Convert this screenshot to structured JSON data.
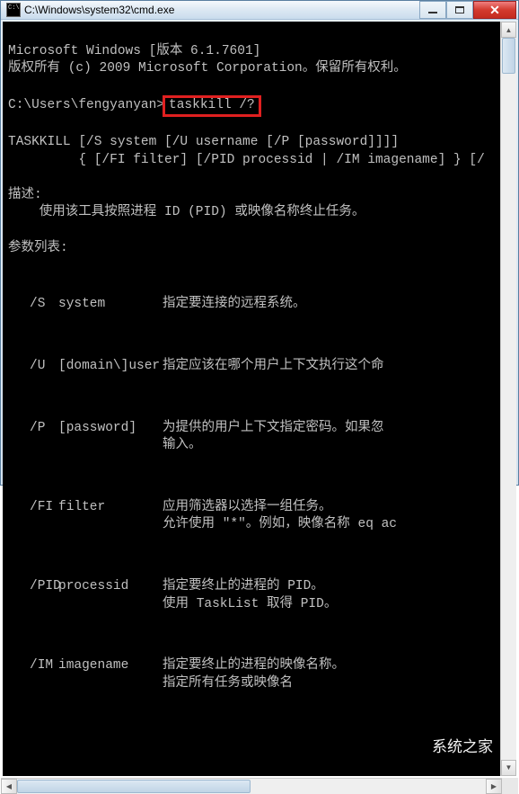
{
  "title": "C:\\Windows\\system32\\cmd.exe",
  "header": {
    "line1": "Microsoft Windows [版本 6.1.7601]",
    "line2": "版权所有 (c) 2009 Microsoft Corporation。保留所有权利。"
  },
  "prompt": {
    "path": "C:\\Users\\fengyanyan>",
    "command": "taskkill /?"
  },
  "usage": {
    "line1": "TASKKILL [/S system [/U username [/P [password]]]]",
    "line2": "         { [/FI filter] [/PID processid | /IM imagename] } [/"
  },
  "description": {
    "heading": "描述:",
    "text": "    使用该工具按照进程 ID (PID) 或映像名称终止任务。"
  },
  "params": {
    "heading": "参数列表:",
    "items": [
      {
        "flag": "/S",
        "name": "system",
        "desc": "指定要连接的远程系统。"
      },
      {
        "flag": "/U",
        "name": "[domain\\]user",
        "desc": "指定应该在哪个用户上下文执行这个命"
      },
      {
        "flag": "/P",
        "name": "[password]",
        "desc": "为提供的用户上下文指定密码。如果忽\n输入。"
      },
      {
        "flag": "/FI",
        "name": "filter",
        "desc": "应用筛选器以选择一组任务。\n允许使用 \"*\"。例如，映像名称 eq ac"
      },
      {
        "flag": "/PID",
        "name": "processid",
        "desc": "指定要终止的进程的 PID。\n使用 TaskList 取得 PID。"
      },
      {
        "flag": "/IM",
        "name": "imagename",
        "desc": "指定要终止的进程的映像名称。\n指定所有任务或映像名"
      }
    ]
  },
  "watermark_text": "系统之家"
}
